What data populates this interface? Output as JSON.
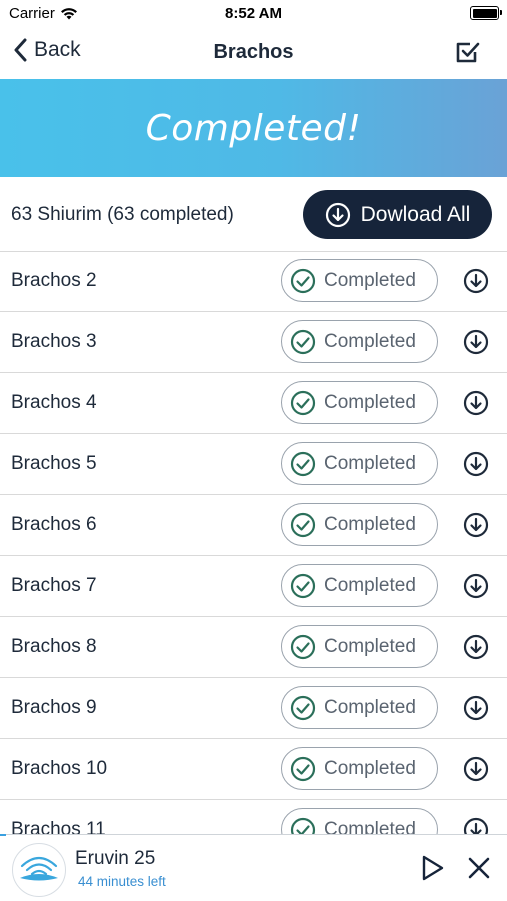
{
  "status_bar": {
    "carrier": "Carrier",
    "time": "8:52 AM"
  },
  "nav": {
    "back_label": "Back",
    "title": "Brachos"
  },
  "banner": {
    "text": "Completed!"
  },
  "summary": {
    "count_text": "63 Shiurim (63 completed)",
    "download_all_label": "Dowload All"
  },
  "shiurim": [
    {
      "name": "Brachos 2",
      "status": "Completed"
    },
    {
      "name": "Brachos 3",
      "status": "Completed"
    },
    {
      "name": "Brachos 4",
      "status": "Completed"
    },
    {
      "name": "Brachos 5",
      "status": "Completed"
    },
    {
      "name": "Brachos 6",
      "status": "Completed"
    },
    {
      "name": "Brachos 7",
      "status": "Completed"
    },
    {
      "name": "Brachos 8",
      "status": "Completed"
    },
    {
      "name": "Brachos 9",
      "status": "Completed"
    },
    {
      "name": "Brachos 10",
      "status": "Completed"
    },
    {
      "name": "Brachos 11",
      "status": "Completed"
    }
  ],
  "player": {
    "title": "Eruvin 25",
    "subtitle": "44 minutes left"
  },
  "colors": {
    "accent_dark": "#16243a",
    "banner_start": "#49c1ea",
    "banner_end": "#6aa2d6",
    "check_green": "#2b6f5a",
    "subtitle_blue": "#3a8fd1"
  }
}
